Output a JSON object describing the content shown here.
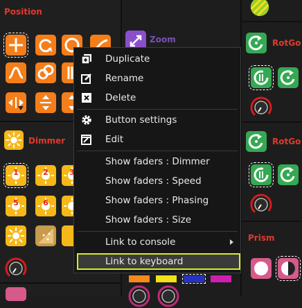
{
  "groups": {
    "position": "Position",
    "dimmer": "Dimmer",
    "zoom": "Zoom",
    "rotgobo_1": "RotGo",
    "rotgobo_2": "RotGo",
    "prism": "Prism"
  },
  "dimmer_numbers": [
    "1",
    "2",
    "3",
    "5",
    "6"
  ],
  "context_menu": {
    "duplicate": "Duplicate",
    "rename": "Rename",
    "delete": "Delete",
    "button_settings": "Button settings",
    "edit": "Edit",
    "show_faders_dimmer": "Show faders : Dimmer",
    "show_faders_speed": "Show faders : Speed",
    "show_faders_phasing": "Show faders : Phasing",
    "show_faders_size": "Show faders : Size",
    "link_to_console": "Link to console",
    "link_to_keyboard": "Link to keyboard"
  },
  "colors": {
    "highlight_border": "#d8ee1e",
    "group_title": "#e03a2c",
    "orange_button": "#f47e1a",
    "yellow_button": "#f5b818",
    "green_button": "#35a853"
  }
}
